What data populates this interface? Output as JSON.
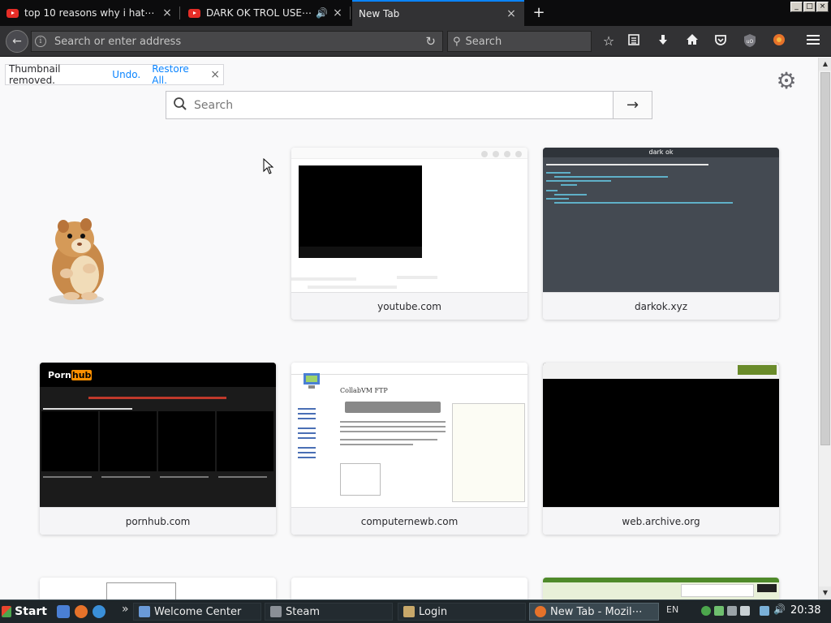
{
  "browser": {
    "tabs": [
      {
        "title": "top 10 reasons why i hat⋯",
        "icon": "youtube-icon"
      },
      {
        "title": "DARK OK TROL USE⋯",
        "icon": "youtube-icon",
        "audio": true
      },
      {
        "title": "New Tab",
        "active": true
      }
    ],
    "new_tab_symbol": "+",
    "window_controls": [
      "_",
      "□",
      "×"
    ],
    "urlbar": {
      "placeholder": "Search or enter address"
    },
    "searchbar": {
      "placeholder": "Search"
    }
  },
  "newtab": {
    "notification": {
      "text": "Thumbnail removed.",
      "undo": "Undo.",
      "restore": "Restore All.",
      "close": "×"
    },
    "search": {
      "placeholder": "Search",
      "go": "→"
    },
    "tiles": [
      {
        "label": "youtube.com"
      },
      {
        "label": "darkok.xyz",
        "thumb_title": "dark ok"
      },
      {
        "label": "pornhub.com",
        "thumb_title": "Porn",
        "thumb_title_badge": "hub"
      },
      {
        "label": "computernewb.com",
        "thumb_title": "CollabVM FTP"
      },
      {
        "label": "web.archive.org"
      }
    ]
  },
  "taskbar": {
    "start": "Start",
    "items": [
      {
        "label": "Welcome Center"
      },
      {
        "label": "Steam"
      },
      {
        "label": "Login"
      },
      {
        "label": "New Tab - Mozil⋯",
        "active": true
      }
    ],
    "lang": "EN",
    "clock": "20:38",
    "overflow": "»"
  },
  "colors": {
    "tab_bg": "#0c0c0d",
    "toolbar_bg": "#323234",
    "accent": "#0a84ff",
    "page_bg": "#f9f9fa",
    "taskbar_bg": "#1e2529"
  }
}
